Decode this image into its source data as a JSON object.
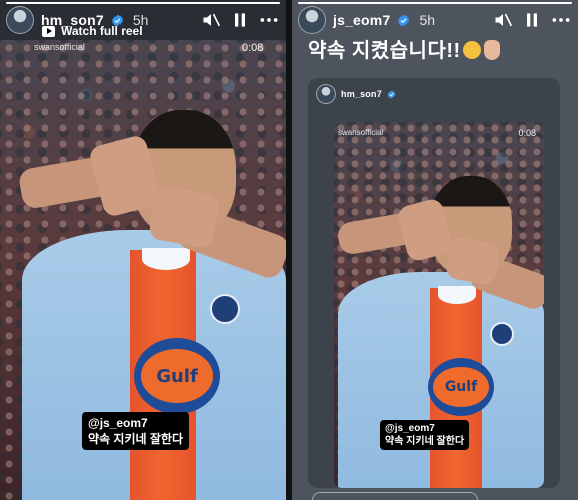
{
  "left_story": {
    "username": "hm_son7",
    "time": "5h",
    "progress_fraction": 1.0,
    "watch_full_reel": "Watch full reel",
    "reel_source": "swansofficial",
    "duration": "0:08",
    "shirt_sponsor": "Gulf",
    "sticker_mention": "@js_eom7",
    "sticker_caption": "약속 지키네 잘한다"
  },
  "right_story": {
    "username": "js_eom7",
    "time": "5h",
    "progress_fraction": 1.0,
    "story_text": "약속 지켰습니다!!",
    "shared_post": {
      "username": "hm_son7",
      "reel_source": "swansofficial",
      "duration": "0:08",
      "shirt_sponsor": "Gulf",
      "sticker_mention": "@js_eom7",
      "sticker_caption": "약속 지키네 잘한다"
    }
  },
  "icons": {
    "verified": "verified-badge-icon",
    "mute": "speaker-muted-icon",
    "pause": "pause-icon",
    "more": "more-options-icon"
  },
  "colors": {
    "verified_blue": "#3897f0",
    "shirt_blue": "#9cc3e4",
    "stripe_orange": "#ef6b2b"
  }
}
